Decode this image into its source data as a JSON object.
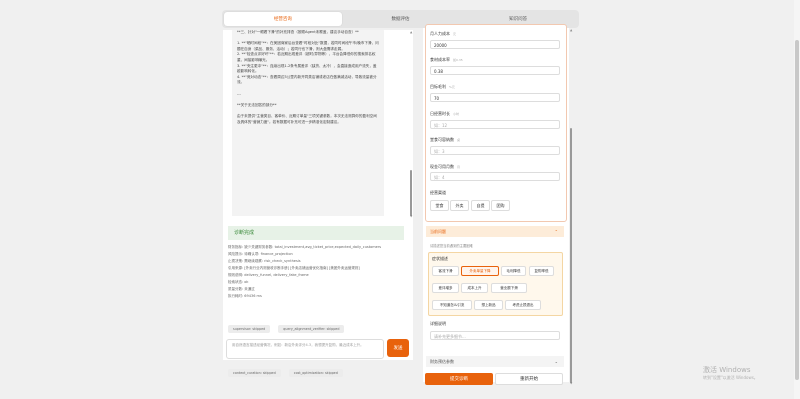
{
  "tabs": [
    {
      "label": "经营咨询"
    },
    {
      "label": "数据评估"
    },
    {
      "label": "知识问答"
    }
  ],
  "chat": {
    "bubble_text": "**三、针对\"一眼看下滑\"的补充排查（按顺Agent未覆盖，建议手动自查）**\n\n1. **\"晒时间段\"**：在美团商家后台查看\"时段对比\"数据，若同时间段午市/晚市下滑，问题在自身（菜品、服务、活动）；若同行也下滑，则大盘需求走弱。\n2. **\"检查点评好坏\"**：若近期出现差评（超时/异物等），平台会降低你的搜索排名权重，间接影响曝光。\n3. **\"夹注更冲\"**：连续出现1-2条专属差评（缺货、太冷），会直接造成用户流失，盖越影响转化。\n4. **\"竞对动态\"**：查看周边3公里内新开同类店铺或老店在做满减活动，导致流量被分流。\n\n---\n\n**关于无法回答的部分**\n\n由于未提供\"主营类目、客单价、近期订单量\"三项关键参数，本次无法测算你的盈利空间及具体的\"营销力度\"。若有数据可补充可进一步精准化定制建议。"
  },
  "diagnosis": {
    "title": "诊断完成",
    "lines": [
      "财务指标: 缺少关键财务参数: total_investment,avg_ticket_price,expected_daily_customers",
      "风险提示: 待确认项: finance_projection",
      "止损决策: 需继续观察: risk_check_synthesis",
      "引用来源: [外卖行业内测营收诊断手册] [外卖店铺运营优化指南] [美团外卖运营规则]",
      "规则说明: delivery_funnel, delivery_fake_frame",
      "检索状态: ok",
      "质量分数: 未通过",
      "执行耗时: 69436 ms"
    ],
    "chips": [
      {
        "label": "supervisor: skipped",
        "ok": false
      },
      {
        "label": "query_alignment_verifier: skipped",
        "ok": false
      },
      {
        "label": "info_completion: completed",
        "ok": true
      },
      {
        "label": "operation_diagnosis: completed",
        "ok": true
      },
      {
        "label": "context_curation: skipped",
        "ok": false
      },
      {
        "label": "cost_optimization: skipped",
        "ok": false
      }
    ]
  },
  "composer": {
    "placeholder": "用自然语言描述经营情况，例如：新店外卖评分4.3，我想提升复购，最近成本上升。",
    "send_label": "发送"
  },
  "form": {
    "fields": [
      {
        "label": "月人力成本",
        "hint": "元",
        "value": "20000",
        "placeholder": ""
      },
      {
        "label": "食材成本率",
        "hint": "如0.35",
        "value": "0.38",
        "placeholder": ""
      },
      {
        "label": "目标毛利",
        "hint": "%元",
        "value": "70",
        "placeholder": ""
      },
      {
        "label": "日经营时长",
        "hint": "小时",
        "value": "",
        "placeholder": "如：12"
      },
      {
        "label": "堂食可容纳数",
        "hint": "桌",
        "value": "",
        "placeholder": "如：3"
      },
      {
        "label": "现金可用月数",
        "hint": "月",
        "value": "",
        "placeholder": "如：4"
      }
    ],
    "channels_label": "经营渠道",
    "channels": [
      "堂食",
      "外卖",
      "自提",
      "团购"
    ],
    "current_issue": {
      "title": "当前问题",
      "subtitle": "请描述您当前遇到的主要困难"
    },
    "issue_label": "症状描述",
    "issues": [
      {
        "label": "客流下滑",
        "selected": false
      },
      {
        "label": "外卖单量下降",
        "selected": true
      },
      {
        "label": "毛利降低",
        "selected": false
      },
      {
        "label": "复购率低",
        "selected": false
      },
      {
        "label": "差评增多",
        "selected": false
      },
      {
        "label": "成本上升",
        "selected": false
      },
      {
        "label": "营业额下滑",
        "selected": false
      },
      {
        "label": "不知道怎么引流",
        "selected": false
      },
      {
        "label": "想上新品",
        "selected": false
      },
      {
        "label": "考虑止损退出",
        "selected": false
      }
    ],
    "detail_label": "详细说明",
    "detail_placeholder": "请补充更多细节...",
    "finance_section": "财务预估参数",
    "submit_label": "提交诊断",
    "reset_label": "重新开始"
  },
  "watermark": {
    "line1": "激活 Windows",
    "line2": "转到\"设置\"以激活 Windows。"
  }
}
